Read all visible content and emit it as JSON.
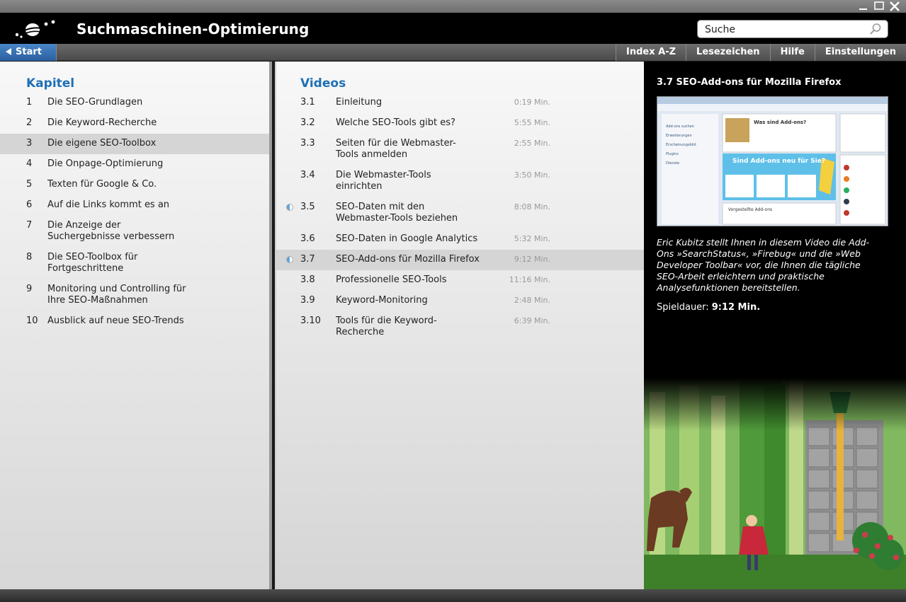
{
  "app": {
    "title": "Suchmaschinen-Optimierung",
    "accent_color": "#1f6fb5"
  },
  "search": {
    "placeholder": "Suche",
    "value": "Suche"
  },
  "nav": {
    "start_label": "Start",
    "tabs": [
      "Index A-Z",
      "Lesezeichen",
      "Hilfe",
      "Einstellungen"
    ]
  },
  "chapters": {
    "heading": "Kapitel",
    "items": [
      {
        "num": "1",
        "label": "Die SEO-Grundlagen"
      },
      {
        "num": "2",
        "label": "Die Keyword-Recherche"
      },
      {
        "num": "3",
        "label": "Die eigene SEO-Toolbox",
        "active": true
      },
      {
        "num": "4",
        "label": "Die Onpage-Optimierung"
      },
      {
        "num": "5",
        "label": "Texten für Google & Co."
      },
      {
        "num": "6",
        "label": "Auf die Links kommt es an"
      },
      {
        "num": "7",
        "label": "Die Anzeige der Suchergebnisse verbessern"
      },
      {
        "num": "8",
        "label": "Die SEO-Toolbox für Fortgeschrittene"
      },
      {
        "num": "9",
        "label": "Monitoring und Controlling für Ihre SEO-Maßnahmen"
      },
      {
        "num": "10",
        "label": "Ausblick auf neue SEO-Trends"
      }
    ]
  },
  "videos": {
    "heading": "Videos",
    "items": [
      {
        "num": "3.1",
        "label": "Einleitung",
        "duration": "0:19 Min."
      },
      {
        "num": "3.2",
        "label": "Welche SEO-Tools gibt es?",
        "duration": "5:55 Min."
      },
      {
        "num": "3.3",
        "label": "Seiten für die Webmaster-Tools anmelden",
        "duration": "2:55 Min."
      },
      {
        "num": "3.4",
        "label": "Die Webmaster-Tools einrichten",
        "duration": "3:50 Min."
      },
      {
        "num": "3.5",
        "label": "SEO-Daten mit den Webmaster-Tools beziehen",
        "duration": "8:08 Min.",
        "progress": 0.5
      },
      {
        "num": "3.6",
        "label": "SEO-Daten in Google Analytics",
        "duration": "5:32 Min."
      },
      {
        "num": "3.7",
        "label": "SEO-Add-ons für Mozilla Firefox",
        "duration": "9:12 Min.",
        "progress": 0.5,
        "active": true
      },
      {
        "num": "3.8",
        "label": "Professionelle SEO-Tools",
        "duration": "11:16 Min."
      },
      {
        "num": "3.9",
        "label": "Keyword-Monitoring",
        "duration": "2:48 Min."
      },
      {
        "num": "3.10",
        "label": "Tools für die Keyword-Recherche",
        "duration": "6:39 Min."
      }
    ]
  },
  "detail": {
    "title": "3.7 SEO-Add-ons für Mozilla Firefox",
    "description": "Eric Kubitz stellt Ihnen in diesem Video die Add-Ons »SearchStatus«, »Firebug« und die »Web Developer Toolbar« vor, die Ihnen die tägliche SEO-Arbeit erleichtern und praktische Analysefunktionen bereitstellen.",
    "duration_label": "Spieldauer:",
    "duration_value": "9:12 Min.",
    "thumbnail": {
      "heading": "Was sind Add-ons?",
      "banner": "Sind Add-ons neu für Sie?",
      "sidebar_items": [
        "Add-ons suchen",
        "Erweiterungen",
        "Erscheinungsbild",
        "Plugins",
        "Dienste"
      ],
      "footer_label": "Vorgestellte Add-ons"
    }
  }
}
